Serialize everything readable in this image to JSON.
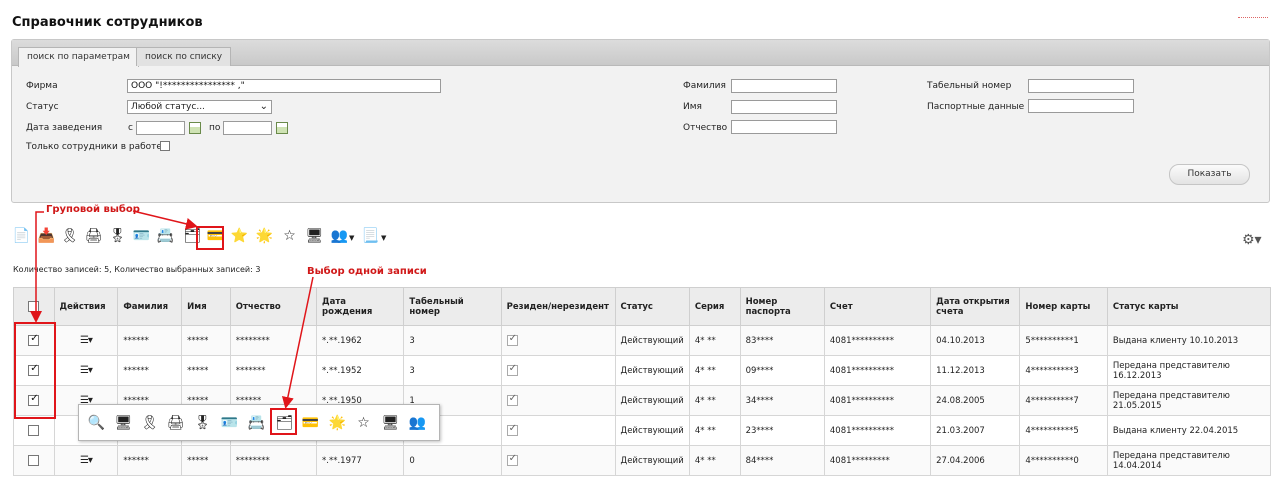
{
  "page_title": "Справочник сотрудников",
  "tabs": [
    "поиск по параметрам",
    "поиск по списку"
  ],
  "filters": {
    "firm_label": "Фирма",
    "firm_value": "ООО \"!**************** ,\"",
    "status_label": "Статус",
    "status_value": "Любой статус...",
    "date_label": "Дата заведения",
    "date_from_label": "с",
    "date_to_label": "по",
    "only_working_label": "Только сотрудники в работе",
    "surname_label": "Фамилия",
    "name_label": "Имя",
    "patronymic_label": "Отчество",
    "tab_number_label": "Табельный номер",
    "passport_label": "Паспортные данные",
    "show_button": "Показать"
  },
  "annotations": {
    "group_select": "Груповой выбор",
    "single_select": "Выбор одной записи"
  },
  "counts_text": "Количество записей: 5, Количество выбранных записей: 3",
  "table": {
    "columns": [
      "",
      "Действия",
      "Фамилия",
      "Имя",
      "Отчество",
      "Дата рождения",
      "Табельный номер",
      "Резиден/нерезидент",
      "Статус",
      "Серия",
      "Номер паспорта",
      "Счет",
      "Дата открытия счета",
      "Номер карты",
      "Статус карты"
    ],
    "rows": [
      {
        "checked": true,
        "surname": "******",
        "name": "*****",
        "patronymic": "********",
        "birth": "*.**.1962",
        "tab": "3",
        "resident": true,
        "status": "Действующий",
        "series": "4* **",
        "passport": "83****",
        "account": "4081**********",
        "opened": "04.10.2013",
        "card": "5**********1",
        "card_status": "Выдана клиенту 10.10.2013"
      },
      {
        "checked": true,
        "surname": "******",
        "name": "*****",
        "patronymic": "*******",
        "birth": "*.**.1952",
        "tab": "3",
        "resident": true,
        "status": "Действующий",
        "series": "4* **",
        "passport": "09****",
        "account": "4081**********",
        "opened": "11.12.2013",
        "card": "4**********3",
        "card_status": "Передана представителю 16.12.2013"
      },
      {
        "checked": true,
        "surname": "******",
        "name": "*****",
        "patronymic": "******",
        "birth": "*.**.1950",
        "tab": "1",
        "resident": true,
        "status": "Действующий",
        "series": "4* **",
        "passport": "34****",
        "account": "4081**********",
        "opened": "24.08.2005",
        "card": "4**********7",
        "card_status": "Передана представителю 21.05.2015"
      },
      {
        "checked": false,
        "surname": "",
        "name": "",
        "patronymic": "",
        "birth": "",
        "tab": "",
        "resident": true,
        "status": "Действующий",
        "series": "4* **",
        "passport": "23****",
        "account": "4081**********",
        "opened": "21.03.2007",
        "card": "4**********5",
        "card_status": "Выдана клиенту 22.04.2015"
      },
      {
        "checked": false,
        "surname": "******",
        "name": "*****",
        "patronymic": "********",
        "birth": "*.**.1977",
        "tab": "0",
        "resident": true,
        "status": "Действующий",
        "series": "4* **",
        "passport": "84****",
        "account": "4081*********",
        "opened": "27.04.2006",
        "card": "4**********0",
        "card_status": "Передана представителю 14.04.2014"
      }
    ]
  },
  "colors": {
    "accent_red": "#e0151a",
    "annotation_red": "#d01818",
    "header_bg": "#ececec",
    "panel_bg": "#f2f2f2"
  }
}
